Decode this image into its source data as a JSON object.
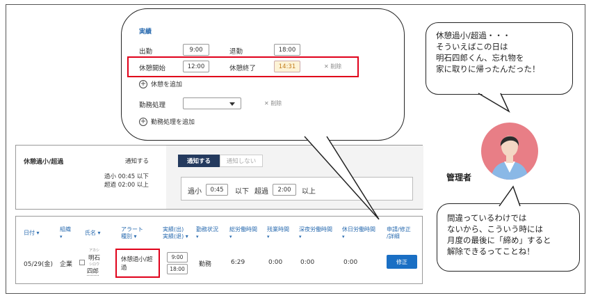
{
  "popup": {
    "section_title": "実績",
    "clock_in_label": "出勤",
    "clock_in_value": "9:00",
    "clock_out_label": "退勤",
    "clock_out_value": "18:00",
    "break_start_label": "休憩開始",
    "break_start_value": "12:00",
    "break_end_label": "休憩終了",
    "break_end_value": "14:31",
    "delete_label": "削除",
    "add_break_label": "休憩を追加",
    "work_processing_label": "勤務処理",
    "work_processing_value": "",
    "delete_label_2": "削除",
    "add_work_processing_label": "勤務処理を追加"
  },
  "notification_panel": {
    "title": "休憩過小/超過",
    "notify_label": "通知する",
    "under_text": "過小 00:45 以下",
    "over_text": "超過 02:00 以上",
    "toggle_on": "通知する",
    "toggle_off": "通知しない",
    "under_label": "過小",
    "under_value": "0:45",
    "below_label": "以下",
    "over_label": "超過",
    "over_value": "2:00",
    "above_label": "以上"
  },
  "table": {
    "headers": {
      "date": "日付",
      "org": "組織",
      "name": "氏名",
      "alert_1": "アラート",
      "alert_2": "種別",
      "actual_1": "実績(出)",
      "actual_2": "実績(退)",
      "status": "勤務状況",
      "total": "総労働時間",
      "overtime": "残業時間",
      "night": "深夜労働時間",
      "holiday": "休日労働時間",
      "request_1": "申請/修正",
      "request_2": "/詳細"
    },
    "row": {
      "date": "05/29(金)",
      "org": "企業",
      "name_furigana": "アカシ",
      "name_line1": "明石",
      "name_furigana2": "シロウ",
      "name_line2": "四郎",
      "alert_line1": "休憩過小/超",
      "alert_line2": "過",
      "in": "9:00",
      "out": "18:00",
      "status": "勤務",
      "total": "6:29",
      "overtime": "0:00",
      "night": "0:00",
      "holiday": "0:00",
      "fix_button": "修正"
    }
  },
  "bubble_top": {
    "line1": "休憩過小/超過・・・",
    "line2": "そういえばこの日は",
    "line3": "明石四郎くん、忘れ物を",
    "line4": "家に取りに帰ったんだった！"
  },
  "manager_label": "管理者",
  "bubble_bottom": {
    "line1": "間違っているわけでは",
    "line2": "ないから、こういう時には",
    "line3": "月度の最後に「締め」すると",
    "line4": "解除できるってことね！"
  },
  "colors": {
    "accent_blue": "#2b6cb0",
    "toggle_navy": "#243a5e",
    "highlight_red": "#e0001a",
    "avatar_pink": "#e87e86",
    "button_blue": "#1a6fc4"
  }
}
